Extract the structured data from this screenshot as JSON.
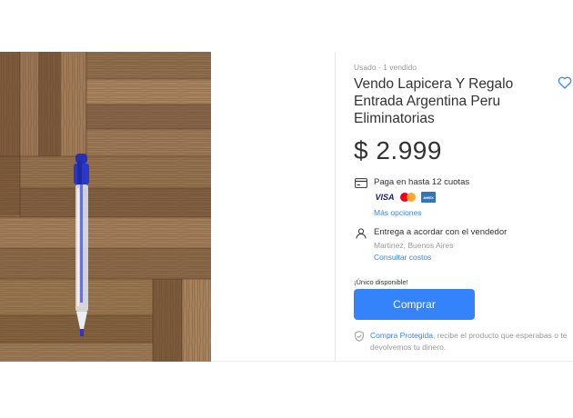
{
  "product": {
    "condition": "Usado  -  1 vendido",
    "title": "Vendo Lapicera Y Regalo Entrada Argentina Peru Eliminatorias",
    "price": "$ 2.999",
    "image_icon": "photo-pen-on-wooden-floor"
  },
  "payment": {
    "text": "Paga en hasta 12 cuotas",
    "cards": [
      "VISA",
      "Mastercard",
      "AMEX"
    ],
    "more_options": "Más opciones"
  },
  "shipping": {
    "text": "Entrega a acordar con el vendedor",
    "location": "Martinez, Buenos Aires",
    "costs_link": "Consultar costos"
  },
  "stock": "¡Único disponible!",
  "buy_button": "Comprar",
  "protection": {
    "link": "Compra Protegida",
    "text": ", recibe el producto que esperabas o te devolvemos tu dinero."
  },
  "colors": {
    "accent": "#3483fa",
    "muted": "#999999",
    "text": "#333333"
  }
}
